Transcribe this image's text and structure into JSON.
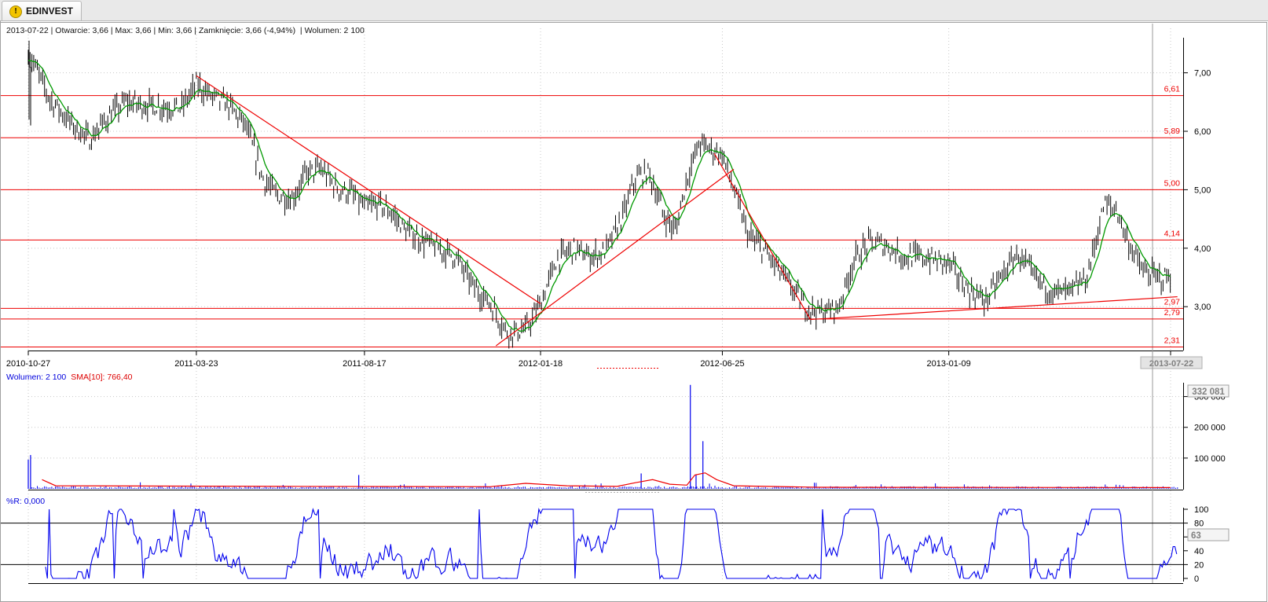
{
  "app": {
    "tab_label": "EDINVEST",
    "tab_icon": "warning-icon"
  },
  "quote_line": "2013-07-22 | Otwarcie: 3,66 | Max: 3,66 | Min: 3,66 | Zamknięcie: 3,66 (-4,94%)  | Wolumen: 2 100",
  "volume_legend": {
    "volume": "Wolumen: 2 100",
    "sma": "SMA[10]: 766,40"
  },
  "wr_legend": "%R: 0,000",
  "colors": {
    "price_bar": "#000000",
    "moving_average": "#009900",
    "horizontal_lines": "#ee0000",
    "trend_lines": "#ee0000",
    "volume_bars": "#0000ee",
    "volume_sma": "#ee0000",
    "williams_r": "#0000ee"
  },
  "chart_data": [
    {
      "type": "line",
      "name": "price",
      "ylim": [
        2.25,
        7.6
      ],
      "y_ticks": [
        {
          "v": 7,
          "label": "7,00"
        },
        {
          "v": 6,
          "label": "6,00"
        },
        {
          "v": 5,
          "label": "5,00"
        },
        {
          "v": 4,
          "label": "4,00"
        },
        {
          "v": 3,
          "label": "3,00"
        }
      ],
      "x_ticks": [
        "2010-10-27",
        "2011-03-23",
        "2011-08-17",
        "2012-01-18",
        "2012-06-25",
        "2013-01-09",
        "2013-07-22"
      ],
      "cursor_date": "2013-07-22",
      "horizontal_levels": [
        {
          "v": 6.61,
          "label": "6,61"
        },
        {
          "v": 5.89,
          "label": "5,89"
        },
        {
          "v": 5.0,
          "label": "5,00"
        },
        {
          "v": 4.14,
          "label": "4,14"
        },
        {
          "v": 2.97,
          "label": "2,97"
        },
        {
          "v": 2.79,
          "label": "2,79"
        },
        {
          "v": 2.31,
          "label": "2,31"
        }
      ],
      "trend_lines": [
        {
          "from": [
            "2011-03-23",
            6.95
          ],
          "to": [
            "2012-01-18",
            3.05
          ]
        },
        {
          "from": [
            "2011-12-10",
            2.33
          ],
          "to": [
            "2012-07-05",
            5.35
          ]
        },
        {
          "from": [
            "2012-06-18",
            5.62
          ],
          "to": [
            "2012-09-10",
            2.78
          ]
        },
        {
          "from": [
            "2012-09-10",
            2.78
          ],
          "to": [
            "2013-07-28",
            3.17
          ]
        }
      ],
      "series": [
        {
          "values": [
            [
              "2010-10-27",
              7.35
            ],
            [
              "2010-11-15",
              6.55
            ],
            [
              "2010-12-05",
              6.1
            ],
            [
              "2010-12-20",
              5.85
            ],
            [
              "2011-01-05",
              6.25
            ],
            [
              "2011-01-20",
              6.5
            ],
            [
              "2011-02-05",
              6.45
            ],
            [
              "2011-02-25",
              6.42
            ],
            [
              "2011-03-10",
              6.4
            ],
            [
              "2011-03-23",
              6.8
            ],
            [
              "2011-04-05",
              6.6
            ],
            [
              "2011-04-20",
              6.45
            ],
            [
              "2011-05-05",
              6.1
            ],
            [
              "2011-05-20",
              5.2
            ],
            [
              "2011-06-01",
              4.9
            ],
            [
              "2011-06-15",
              4.85
            ],
            [
              "2011-06-28",
              5.3
            ],
            [
              "2011-07-10",
              5.35
            ],
            [
              "2011-07-25",
              5.0
            ],
            [
              "2011-08-05",
              4.95
            ],
            [
              "2011-08-17",
              4.7
            ],
            [
              "2011-08-30",
              4.75
            ],
            [
              "2011-09-10",
              4.6
            ],
            [
              "2011-09-22",
              4.3
            ],
            [
              "2011-10-05",
              4.15
            ],
            [
              "2011-10-20",
              4.0
            ],
            [
              "2011-11-05",
              3.85
            ],
            [
              "2011-11-20",
              3.35
            ],
            [
              "2011-12-05",
              3.05
            ],
            [
              "2011-12-20",
              2.55
            ],
            [
              "2012-01-05",
              2.6
            ],
            [
              "2012-01-18",
              3.05
            ],
            [
              "2012-02-01",
              3.8
            ],
            [
              "2012-02-15",
              4.0
            ],
            [
              "2012-03-01",
              3.85
            ],
            [
              "2012-03-15",
              3.95
            ],
            [
              "2012-03-30",
              4.55
            ],
            [
              "2012-04-10",
              5.2
            ],
            [
              "2012-04-22",
              5.3
            ],
            [
              "2012-05-05",
              4.55
            ],
            [
              "2012-05-15",
              4.3
            ],
            [
              "2012-05-25",
              5.2
            ],
            [
              "2012-06-05",
              5.8
            ],
            [
              "2012-06-15",
              5.7
            ],
            [
              "2012-06-25",
              5.6
            ],
            [
              "2012-07-05",
              5.0
            ],
            [
              "2012-07-18",
              4.2
            ],
            [
              "2012-08-01",
              3.95
            ],
            [
              "2012-08-20",
              3.45
            ],
            [
              "2012-09-05",
              3.0
            ],
            [
              "2012-09-20",
              2.9
            ],
            [
              "2012-10-05",
              3.0
            ],
            [
              "2012-10-18",
              3.8
            ],
            [
              "2012-11-01",
              4.1
            ],
            [
              "2012-11-15",
              4.05
            ],
            [
              "2012-12-01",
              3.85
            ],
            [
              "2012-12-15",
              3.85
            ],
            [
              "2013-01-09",
              3.75
            ],
            [
              "2013-01-25",
              3.3
            ],
            [
              "2013-02-10",
              3.1
            ],
            [
              "2013-02-25",
              3.55
            ],
            [
              "2013-03-10",
              3.9
            ],
            [
              "2013-03-25",
              3.5
            ],
            [
              "2013-04-10",
              3.25
            ],
            [
              "2013-04-25",
              3.25
            ],
            [
              "2013-05-10",
              3.5
            ],
            [
              "2013-05-25",
              4.75
            ],
            [
              "2013-06-05",
              4.65
            ],
            [
              "2013-06-15",
              4.1
            ],
            [
              "2013-06-28",
              3.6
            ],
            [
              "2013-07-10",
              3.5
            ],
            [
              "2013-07-22",
              3.5
            ]
          ]
        }
      ]
    },
    {
      "type": "bar",
      "name": "volume",
      "ylim": [
        0,
        345000
      ],
      "y_ticks": [
        {
          "v": 300000,
          "label": "300 000"
        },
        {
          "v": 200000,
          "label": "200 000"
        },
        {
          "v": 100000,
          "label": "100 000"
        }
      ],
      "max_label": "332 081",
      "spikes": [
        [
          "2010-10-27",
          95000
        ],
        [
          "2010-10-29",
          110000
        ],
        [
          "2011-08-12",
          45000
        ],
        [
          "2012-04-15",
          50000
        ],
        [
          "2012-05-28",
          338000
        ],
        [
          "2012-06-08",
          155000
        ],
        [
          "2012-06-02",
          45000
        ]
      ],
      "sma_values": [
        [
          "2010-11-08",
          30000
        ],
        [
          "2010-11-20",
          10000
        ],
        [
          "2011-06-01",
          8000
        ],
        [
          "2011-12-05",
          7000
        ],
        [
          "2012-01-05",
          18000
        ],
        [
          "2012-02-10",
          10000
        ],
        [
          "2012-03-25",
          8000
        ],
        [
          "2012-04-10",
          20000
        ],
        [
          "2012-04-25",
          30000
        ],
        [
          "2012-05-10",
          15000
        ],
        [
          "2012-05-25",
          12000
        ],
        [
          "2012-06-01",
          45000
        ],
        [
          "2012-06-10",
          52000
        ],
        [
          "2012-06-20",
          30000
        ],
        [
          "2012-07-05",
          10000
        ],
        [
          "2012-09-15",
          5000
        ],
        [
          "2013-07-22",
          4000
        ]
      ]
    },
    {
      "type": "line",
      "name": "williams_r",
      "ylim": [
        0,
        100
      ],
      "y_ticks": [
        {
          "v": 100,
          "label": "100"
        },
        {
          "v": 80,
          "label": "80"
        },
        {
          "v": 60,
          "label": "60"
        },
        {
          "v": 40,
          "label": "40"
        },
        {
          "v": 20,
          "label": "20"
        },
        {
          "v": 0,
          "label": "0"
        }
      ],
      "levels": [
        80,
        20
      ],
      "current_label": "63"
    }
  ]
}
